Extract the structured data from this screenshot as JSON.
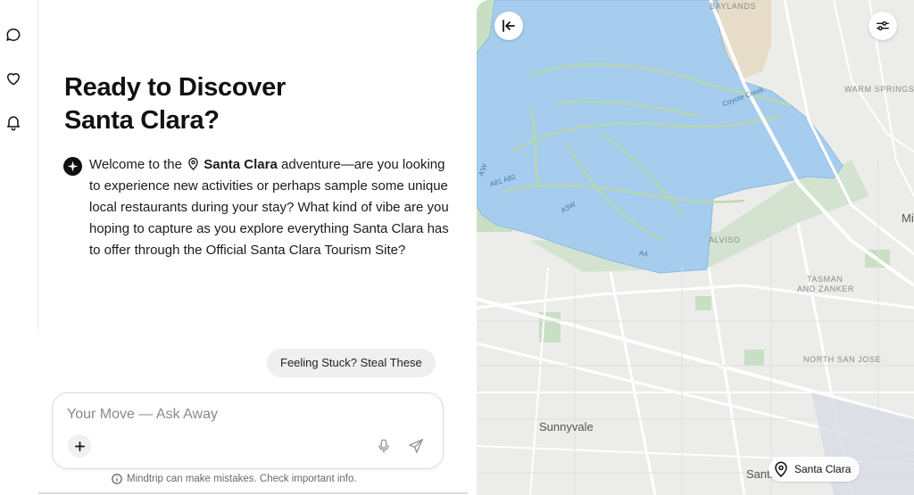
{
  "sidebar": {
    "icons": [
      "chat-bubble-icon",
      "heart-icon",
      "bell-icon"
    ]
  },
  "chat": {
    "title_line1": "Ready to Discover",
    "title_line2": "Santa Clara?",
    "message": {
      "prefix": "Welcome to the",
      "place": "Santa Clara",
      "suffix": "adventure—are you looking to experience new activities or perhaps sample some unique local restaurants during your stay? What kind of vibe are you hoping to capture as you explore everything Santa Clara has to offer through the Official Santa Clara Tourism Site?"
    },
    "suggestion_button": "Feeling Stuck? Steal These",
    "input": {
      "placeholder": "Your Move — Ask Away",
      "value": ""
    },
    "disclaimer": "Mindtrip can make mistakes. Check important info."
  },
  "map": {
    "labels": {
      "baylands": "BAYLANDS",
      "warm_springs": "WARM SPRINGS",
      "alviso": "ALVISO",
      "tasman_l1": "TASMAN",
      "tasman_l2": "AND ZANKER",
      "north_san_jose": "NORTH SAN JOSE",
      "sunnyvale": "Sunnyvale",
      "santa_clara_partial": "Santa",
      "mi_partial": "Mi",
      "coyote_creek": "Coyote Creek",
      "a1_a2": "A81 A82",
      "a3w": "A3W",
      "a4": "A4",
      "a_w": "A’W"
    },
    "marker_label": "Santa Clara",
    "colors": {
      "water": "#a6cdee",
      "water_edge": "#8db9e0",
      "land": "#ececeb",
      "marsh": "#c9dfc4",
      "sand": "#e6dcc8",
      "road": "#ffffff"
    }
  }
}
